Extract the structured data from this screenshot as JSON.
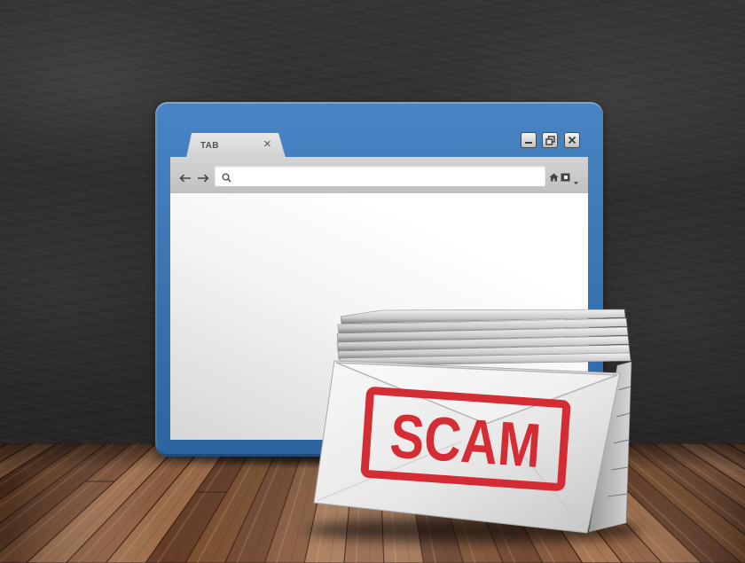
{
  "browser": {
    "tab": {
      "label": "TAB",
      "close_glyph": "×"
    },
    "address_bar": {
      "value": ""
    },
    "toolbar_icons": [
      "back-arrow-icon",
      "forward-arrow-icon",
      "search-icon",
      "home-icon",
      "bookmark-icon",
      "chevron-down-icon"
    ],
    "window_controls": [
      "minimize-icon",
      "restore-icon",
      "close-icon"
    ],
    "frame_color": "#3477bd"
  },
  "envelope": {
    "stamp": {
      "text": "SCAM",
      "color": "#d4232b"
    }
  },
  "colors": {
    "wall": "#2e2e2e",
    "floor": "#8c5a3b",
    "page_background": "#ffffff"
  }
}
